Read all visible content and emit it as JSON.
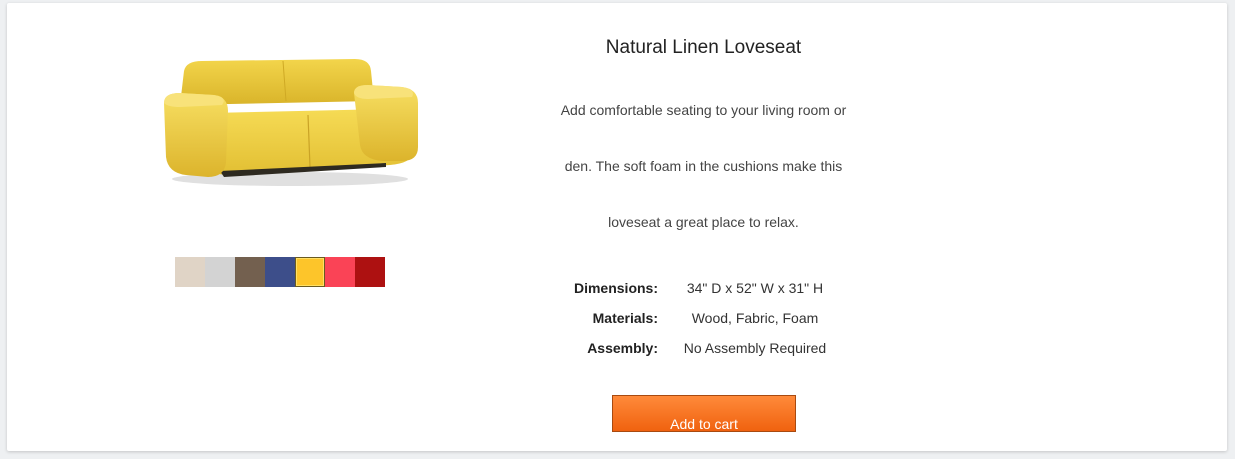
{
  "product": {
    "title": "Natural Linen Loveseat",
    "description_lines": [
      "Add comfortable seating to your living room or",
      "den. The soft foam in the cushions make this",
      "loveseat a great place to relax."
    ],
    "image_icon": "yellow-loveseat-image",
    "swatches": [
      {
        "color": "#e0d4c6"
      },
      {
        "color": "#d3d3d3"
      },
      {
        "color": "#73604f"
      },
      {
        "color": "#3d4e8a"
      },
      {
        "color": "#fdc52a",
        "selected": true
      },
      {
        "color": "#fa4356"
      },
      {
        "color": "#ad1111"
      }
    ],
    "specs": [
      {
        "label": "Dimensions:",
        "value": "34\" D x 52\" W x 31\" H"
      },
      {
        "label": "Materials:",
        "value": "Wood, Fabric, Foam"
      },
      {
        "label": "Assembly:",
        "value": "No Assembly Required"
      }
    ],
    "cart_label": "Add to cart",
    "accent_color": "#f26d1f"
  }
}
